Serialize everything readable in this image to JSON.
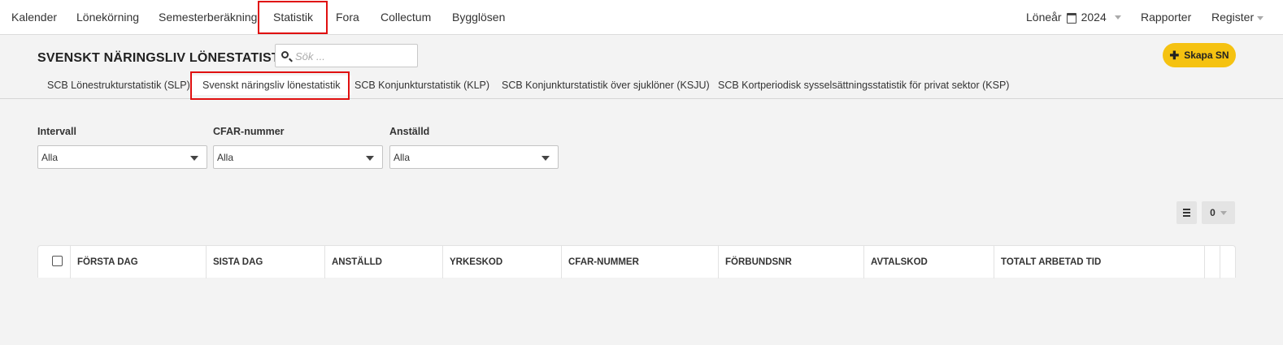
{
  "topnav": {
    "items": [
      "Kalender",
      "Lönekörning",
      "Semesterberäkning",
      "Statistik",
      "Fora",
      "Collectum",
      "Bygglösen"
    ],
    "active": "Statistik",
    "loneyear_label": "Löneår",
    "year": "2024",
    "reports": "Rapporter",
    "register": "Register"
  },
  "header": {
    "title": "SVENSKT NÄRINGSLIV LÖNESTATISTIK",
    "search_placeholder": "Sök ...",
    "create_button": "Skapa SN"
  },
  "subtabs": {
    "items": [
      "SCB Lönestrukturstatistik (SLP)",
      "Svenskt näringsliv lönestatistik",
      "SCB Konjunkturstatistik (KLP)",
      "SCB Konjunkturstatistik över sjuklöner (KSJU)",
      "SCB Kortperiodisk sysselsättningsstatistik för privat sektor (KSP)"
    ],
    "active": "Svenskt näringsliv lönestatistik"
  },
  "filters": [
    {
      "label": "Intervall",
      "value": "Alla"
    },
    {
      "label": "CFAR-nummer",
      "value": "Alla"
    },
    {
      "label": "Anställd",
      "value": "Alla"
    }
  ],
  "toolbar": {
    "list_icon": "list-icon",
    "count": "0"
  },
  "table": {
    "columns": [
      "FÖRSTA DAG",
      "SISTA DAG",
      "ANSTÄLLD",
      "YRKESKOD",
      "CFAR-NUMMER",
      "FÖRBUNDSNR",
      "AVTALSKOD",
      "TOTALT ARBETAD TID"
    ],
    "rows": []
  },
  "colors": {
    "accent_button": "#f5c211",
    "highlight_box": "#e01010",
    "background": "#f3f3f3"
  }
}
